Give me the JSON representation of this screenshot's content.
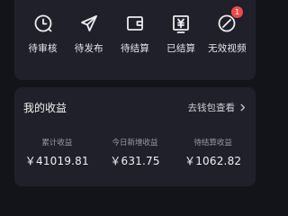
{
  "orders": {
    "items": [
      {
        "label": "待审核",
        "icon": "clock-icon"
      },
      {
        "label": "待发布",
        "icon": "send-icon"
      },
      {
        "label": "待结算",
        "icon": "wallet-icon"
      },
      {
        "label": "已结算",
        "icon": "yen-card-icon"
      },
      {
        "label": "无效视频",
        "icon": "invalid-icon",
        "badge": "1"
      }
    ]
  },
  "income": {
    "title": "我的收益",
    "wallet_link": "去钱包查看",
    "stats": [
      {
        "label": "累计收益",
        "value": "￥41019.81"
      },
      {
        "label": "今日新增收益",
        "value": "￥631.75"
      },
      {
        "label": "待结算收益",
        "value": "￥1062.82"
      }
    ]
  },
  "colors": {
    "background": "#13141a",
    "card": "#1f2029",
    "badge": "#ef4a4a",
    "text": "#e9e9ee",
    "muted": "#9a9aa6"
  }
}
